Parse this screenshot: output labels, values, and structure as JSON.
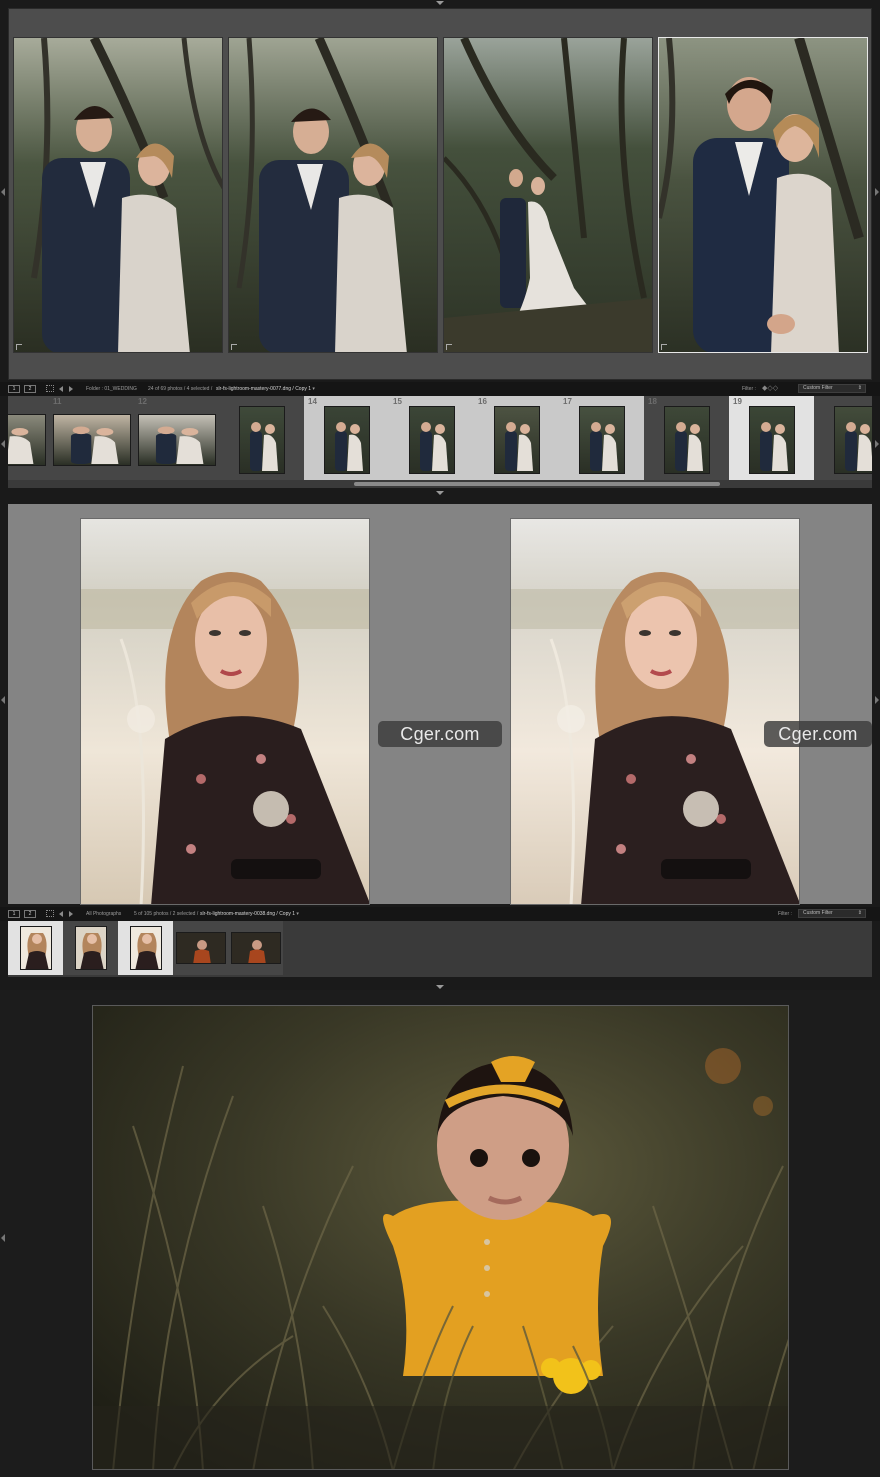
{
  "panel1": {
    "toolbar": {
      "view_btn_1": "1",
      "view_btn_2": "2",
      "source_label": "Folder : 01_WEDDING",
      "count_text": "24 of 69 photos / 4 selected /",
      "filename": "slr-fs-lightroom-mastery-0077.dng / Copy 1",
      "filter_label": "Filter :",
      "filter_value": "Custom Filter"
    },
    "cells": [
      {
        "num": ""
      },
      {
        "num": "11"
      },
      {
        "num": "12"
      },
      {
        "num": ""
      },
      {
        "num": "14"
      },
      {
        "num": "15"
      },
      {
        "num": "16"
      },
      {
        "num": "17"
      },
      {
        "num": "18"
      },
      {
        "num": "19"
      },
      {
        "num": ""
      }
    ]
  },
  "panel2": {
    "watermark_left": "Cger.com",
    "watermark_right": "Cger.com",
    "toolbar": {
      "view_btn_1": "1",
      "view_btn_2": "2",
      "source_label": "All Photographs",
      "count_text": "5 of 105 photos / 2 selected /",
      "filename": "slr-fs-lightroom-mastery-0038.dng / Copy 1",
      "filter_label": "Filter :",
      "filter_value": "Custom Filter"
    }
  },
  "colors": {
    "app_bg": "#1b1b1b",
    "survey_bg": "#4d4d4d",
    "compare_bg": "#848484",
    "filmstrip_bg": "#3a3a3a",
    "selected_cell": "#c9c9c9",
    "active_cell": "#e2e2e2",
    "dress_yellow": "#e9a21e"
  }
}
